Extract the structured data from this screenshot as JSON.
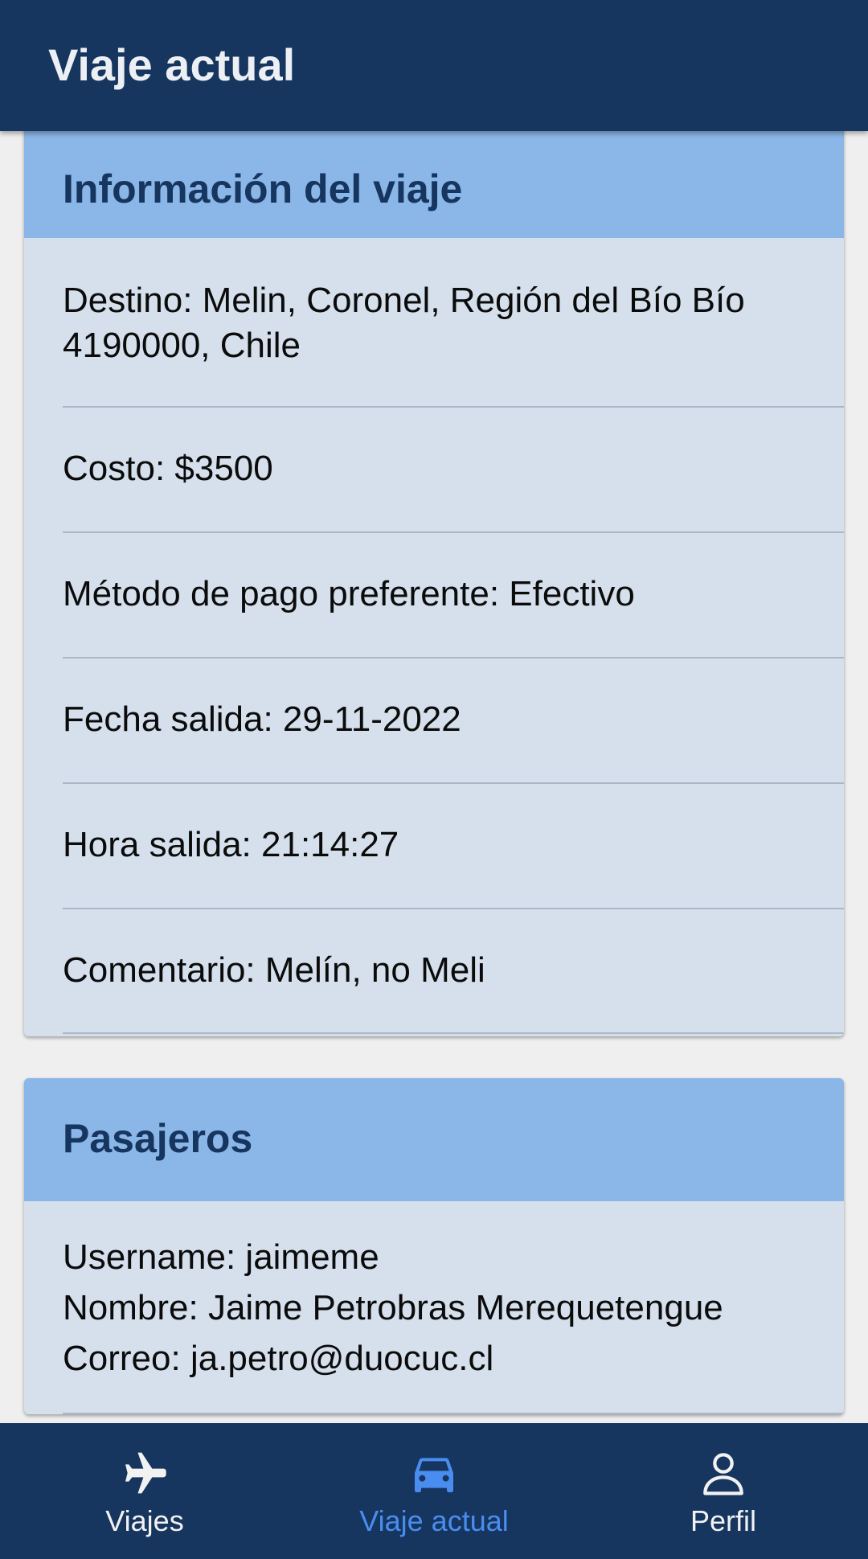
{
  "header": {
    "title": "Viaje actual"
  },
  "trip_info": {
    "title": "Información del viaje",
    "destino_line1": "Destino: Melin, Coronel, Región del Bío Bío",
    "destino_line2": "4190000, Chile",
    "costo": "Costo: $3500",
    "metodo_pago": "Método de pago preferente: Efectivo",
    "fecha_salida": "Fecha salida: 29-11-2022",
    "hora_salida": "Hora salida: 21:14:27",
    "comentario": "Comentario: Melín, no Meli"
  },
  "passengers": {
    "title": "Pasajeros",
    "items": [
      {
        "username": "Username: jaimeme",
        "nombre": "Nombre: Jaime Petrobras Merequetengue",
        "correo": "Correo: ja.petro@duocuc.cl"
      }
    ]
  },
  "bottom_nav": {
    "items": [
      {
        "label": "Viajes",
        "icon": "airplane-icon",
        "active": false
      },
      {
        "label": "Viaje actual",
        "icon": "car-icon",
        "active": true
      },
      {
        "label": "Perfil",
        "icon": "person-icon",
        "active": false
      }
    ]
  },
  "colors": {
    "primary": "#16355f",
    "card_header": "#8bb6e8",
    "card_body": "#d5e0ec",
    "active_tab": "#4a8df0",
    "background": "#efefef"
  }
}
